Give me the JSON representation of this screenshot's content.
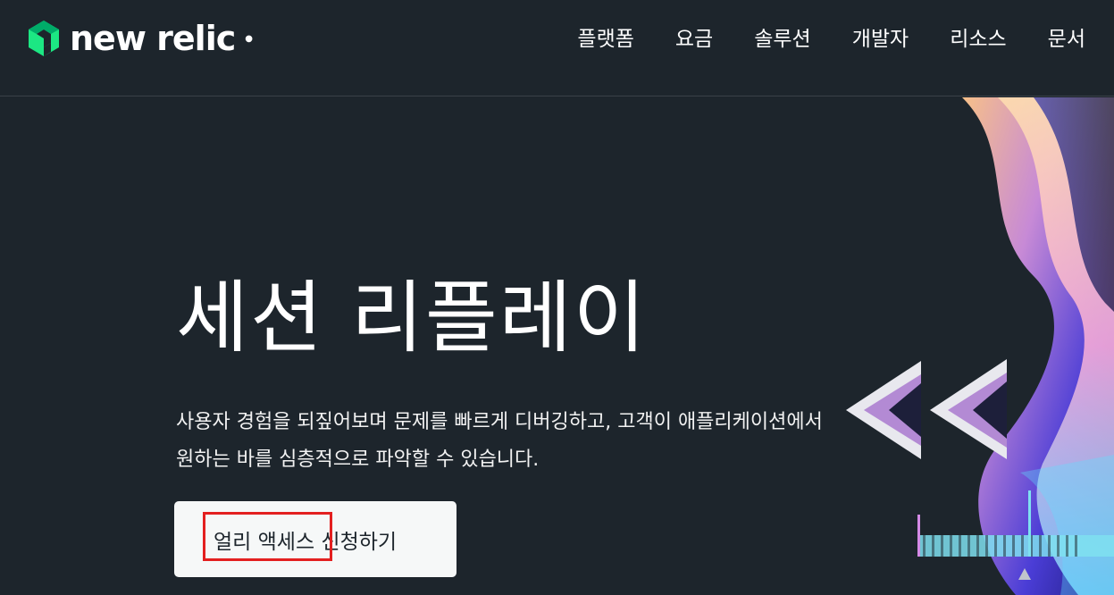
{
  "brand": {
    "name": "new relic",
    "accent": "#1ce783"
  },
  "nav": {
    "items": [
      {
        "label": "플랫폼"
      },
      {
        "label": "요금"
      },
      {
        "label": "솔루션"
      },
      {
        "label": "개발자"
      },
      {
        "label": "리소스"
      },
      {
        "label": "문서"
      }
    ]
  },
  "hero": {
    "title": "세션 리플레이",
    "description": "사용자 경험을 되짚어보며 문제를 빠르게 디버깅하고, 고객이 애플리케이션에서 원하는 바를 심층적으로 파악할 수 있습니다.",
    "cta_label": "얼리 액세스 신청하기"
  },
  "colors": {
    "background": "#1d252c",
    "highlight": "#e32020",
    "button_bg": "#f6f8f8"
  }
}
